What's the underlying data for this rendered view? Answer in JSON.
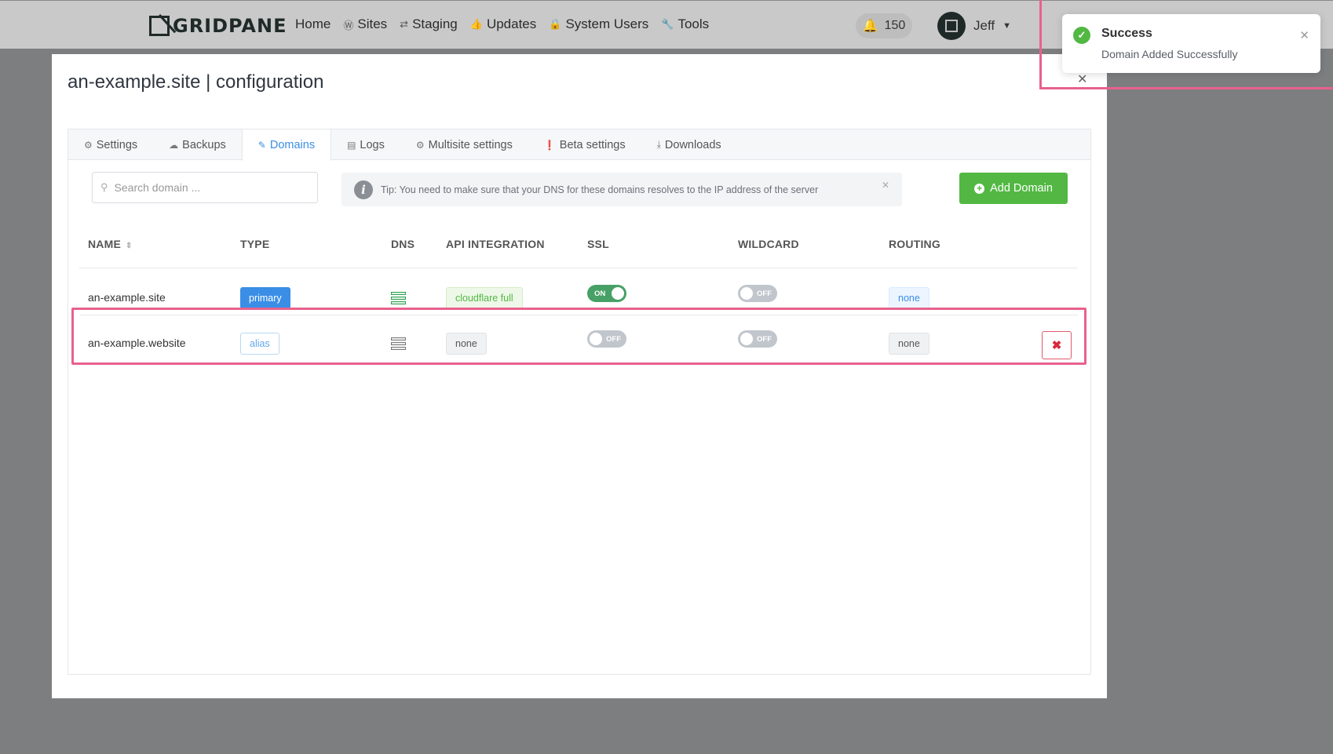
{
  "brand": {
    "logo_text": "GRIDPANE"
  },
  "nav": {
    "items": [
      {
        "label": "Home",
        "icon": ""
      },
      {
        "label": "Sites",
        "icon": "wordpress-icon"
      },
      {
        "label": "Staging",
        "icon": "sync-icon"
      },
      {
        "label": "Updates",
        "icon": "thumbs-up-icon"
      },
      {
        "label": "System Users",
        "icon": "user-lock-icon"
      },
      {
        "label": "Tools",
        "icon": "wrench-icon"
      }
    ],
    "notifications_count": "150",
    "user_name": "Jeff"
  },
  "modal": {
    "title": "an-example.site | configuration",
    "tabs": [
      {
        "label": "Settings",
        "icon": "gear-icon"
      },
      {
        "label": "Backups",
        "icon": "cloud-icon"
      },
      {
        "label": "Domains",
        "icon": "edit-icon",
        "active": true
      },
      {
        "label": "Logs",
        "icon": "document-icon"
      },
      {
        "label": "Multisite settings",
        "icon": "gear-icon"
      },
      {
        "label": "Beta settings",
        "icon": "alert-icon"
      },
      {
        "label": "Downloads",
        "icon": "download-icon"
      }
    ],
    "search_placeholder": "Search domain ...",
    "tip": "Tip: You need to make sure that your DNS for these domains resolves to the IP address of the server",
    "add_button": "Add Domain",
    "table": {
      "headers": {
        "name": "NAME",
        "type": "TYPE",
        "dns": "DNS",
        "api": "API INTEGRATION",
        "ssl": "SSL",
        "wildcard": "WILDCARD",
        "routing": "ROUTING"
      },
      "rows": [
        {
          "name": "an-example.site",
          "type": "primary",
          "api": "cloudflare full",
          "ssl": "ON",
          "wildcard": "OFF",
          "routing": "none"
        },
        {
          "name": "an-example.website",
          "type": "alias",
          "api": "none",
          "ssl": "OFF",
          "wildcard": "OFF",
          "routing": "none"
        }
      ]
    }
  },
  "toast": {
    "title": "Success",
    "message": "Domain Added Successfully"
  },
  "colors": {
    "accent": "#3a8ee6",
    "success": "#52b843",
    "highlight": "#e8618c",
    "danger": "#d9283a"
  }
}
